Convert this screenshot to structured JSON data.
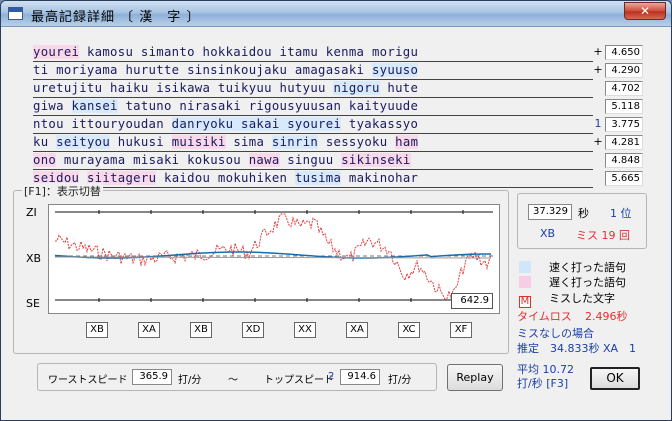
{
  "window": {
    "title": "最高記録詳細 〔 漢　字 〕",
    "close_label": "✕"
  },
  "words": [
    [
      {
        "t": "yourei",
        "c": "slow"
      },
      {
        "t": " kamosu simanto hokkaidou itamu kenma morigu",
        "c": ""
      }
    ],
    [
      {
        "t": "ti moriyama hurutte sinsinkoujaku amagasaki ",
        "c": ""
      },
      {
        "t": "syuuso",
        "c": "fast"
      }
    ],
    [
      {
        "t": "uretujitu haiku isikawa tuikyuu hutyuu ",
        "c": ""
      },
      {
        "t": "nigoru",
        "c": "fast"
      },
      {
        "t": " hute",
        "c": ""
      }
    ],
    [
      {
        "t": "giwa ",
        "c": ""
      },
      {
        "t": "kansei",
        "c": "fast"
      },
      {
        "t": " tatuno nirasaki rigousyuusan kaityuude",
        "c": ""
      }
    ],
    [
      {
        "t": "ntou ittouryoudan ",
        "c": ""
      },
      {
        "t": "danryoku sakai syourei",
        "c": "fast"
      },
      {
        "t": " tyakassyo",
        "c": ""
      }
    ],
    [
      {
        "t": "ku ",
        "c": ""
      },
      {
        "t": "seityou",
        "c": "fast"
      },
      {
        "t": " hukusi ",
        "c": ""
      },
      {
        "t": "muisiki",
        "c": "slow"
      },
      {
        "t": " sima ",
        "c": ""
      },
      {
        "t": "sinrin",
        "c": "fast"
      },
      {
        "t": " sessyoku ",
        "c": ""
      },
      {
        "t": "ham",
        "c": "slow"
      }
    ],
    [
      {
        "t": "ono",
        "c": "slow"
      },
      {
        "t": " murayama misaki kokusou ",
        "c": ""
      },
      {
        "t": "nawa",
        "c": "slow"
      },
      {
        "t": " singuu ",
        "c": ""
      },
      {
        "t": "sikinseki",
        "c": "slow"
      }
    ],
    [
      {
        "t": "seidou",
        "c": "slow"
      },
      {
        "t": " ",
        "c": ""
      },
      {
        "t": "siitageru",
        "c": "slow"
      },
      {
        "t": " kaidou mokuhiken ",
        "c": ""
      },
      {
        "t": "tusima",
        "c": "fast"
      },
      {
        "t": " makinohar",
        "c": ""
      }
    ]
  ],
  "times": [
    {
      "mark": "+",
      "value": "4.650"
    },
    {
      "mark": "+",
      "value": "4.290"
    },
    {
      "mark": "",
      "value": "4.702"
    },
    {
      "mark": "",
      "value": "5.118"
    },
    {
      "mark": "1",
      "value": "3.775"
    },
    {
      "mark": "+",
      "value": "4.281"
    },
    {
      "mark": "",
      "value": "4.848"
    },
    {
      "mark": "",
      "value": "5.665"
    }
  ],
  "graph": {
    "legend": "[F1]：表示切替",
    "y_labels": {
      "top": "ZI",
      "mid": "XB",
      "bottom": "SE"
    },
    "value_box": "642.9",
    "ranks": [
      "XB",
      "XA",
      "XB",
      "XD",
      "XX",
      "XA",
      "XC",
      "XF"
    ]
  },
  "speed": {
    "worst_label": "ワーストスピード",
    "worst_value": "365.9",
    "unit": "打/分",
    "tilde": "〜",
    "top_label": "トップスピード",
    "top_rank": "2",
    "top_value": "914.6"
  },
  "replay_label": "Replay",
  "result": {
    "time_value": "37.329",
    "time_unit": "秒",
    "rank_label": "1 位",
    "grade": "XB",
    "miss_label": "ミス 19 回"
  },
  "legend": {
    "fast": "速く打った語句",
    "slow": "遅く打った語句",
    "miss_mark": "M",
    "miss": "ミスした文字"
  },
  "timeloss": {
    "label": "タイムロス",
    "value": "2.496秒"
  },
  "no_miss": {
    "heading": "ミスなしの場合",
    "estimate": "推定　34.833秒 XA　1"
  },
  "average": {
    "line1": "平均 10.72",
    "line2": "打/秒 [F3]"
  },
  "ok_label": "OK",
  "colors": {
    "miss_red": "#e03030",
    "accent_blue": "#1a3fa8",
    "fast_bg": "#d7eafb",
    "slow_bg": "#f9d8ea"
  }
}
